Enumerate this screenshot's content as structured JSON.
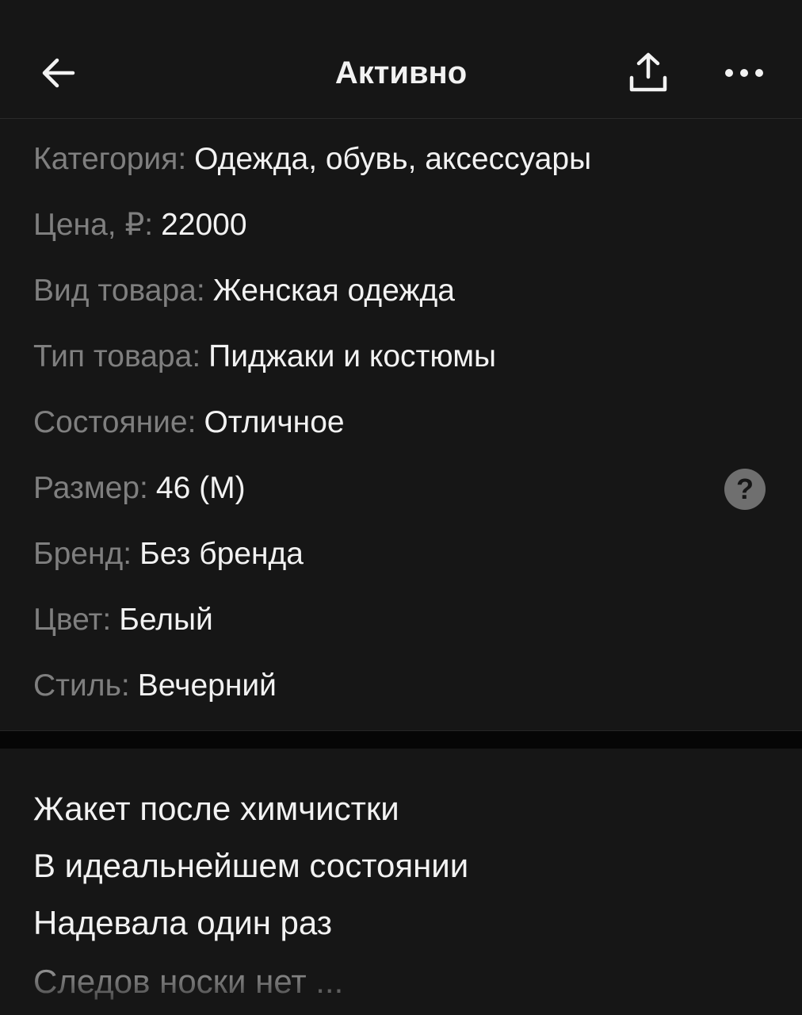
{
  "header": {
    "title": "Активно",
    "back_icon": "arrow-left-icon",
    "share_icon": "share-upload-icon",
    "more_icon": "more-horizontal-icon"
  },
  "params": [
    {
      "label": "Категория",
      "value": "Одежда, обувь, аксессуары"
    },
    {
      "label": "Цена, ₽",
      "value": "22000"
    },
    {
      "label": "Вид товара",
      "value": "Женская одежда"
    },
    {
      "label": "Тип товара",
      "value": "Пиджаки и костюмы"
    },
    {
      "label": "Состояние",
      "value": "Отличное"
    },
    {
      "label": "Размер",
      "value": "46 (M)"
    },
    {
      "label": "Бренд",
      "value": "Без бренда"
    },
    {
      "label": "Цвет",
      "value": "Белый"
    },
    {
      "label": "Стиль",
      "value": "Вечерний"
    }
  ],
  "separator": ":",
  "size_help": {
    "icon": "help-circle-icon",
    "glyph": "?"
  },
  "description": {
    "lines": [
      "Жакет после химчистки",
      "В идеальнейшем состоянии",
      "Надевала один раз",
      "Следов носки нет ..."
    ]
  },
  "colors": {
    "background": "#161616",
    "label": "#7f7f7f",
    "text": "#f2f2f2"
  }
}
